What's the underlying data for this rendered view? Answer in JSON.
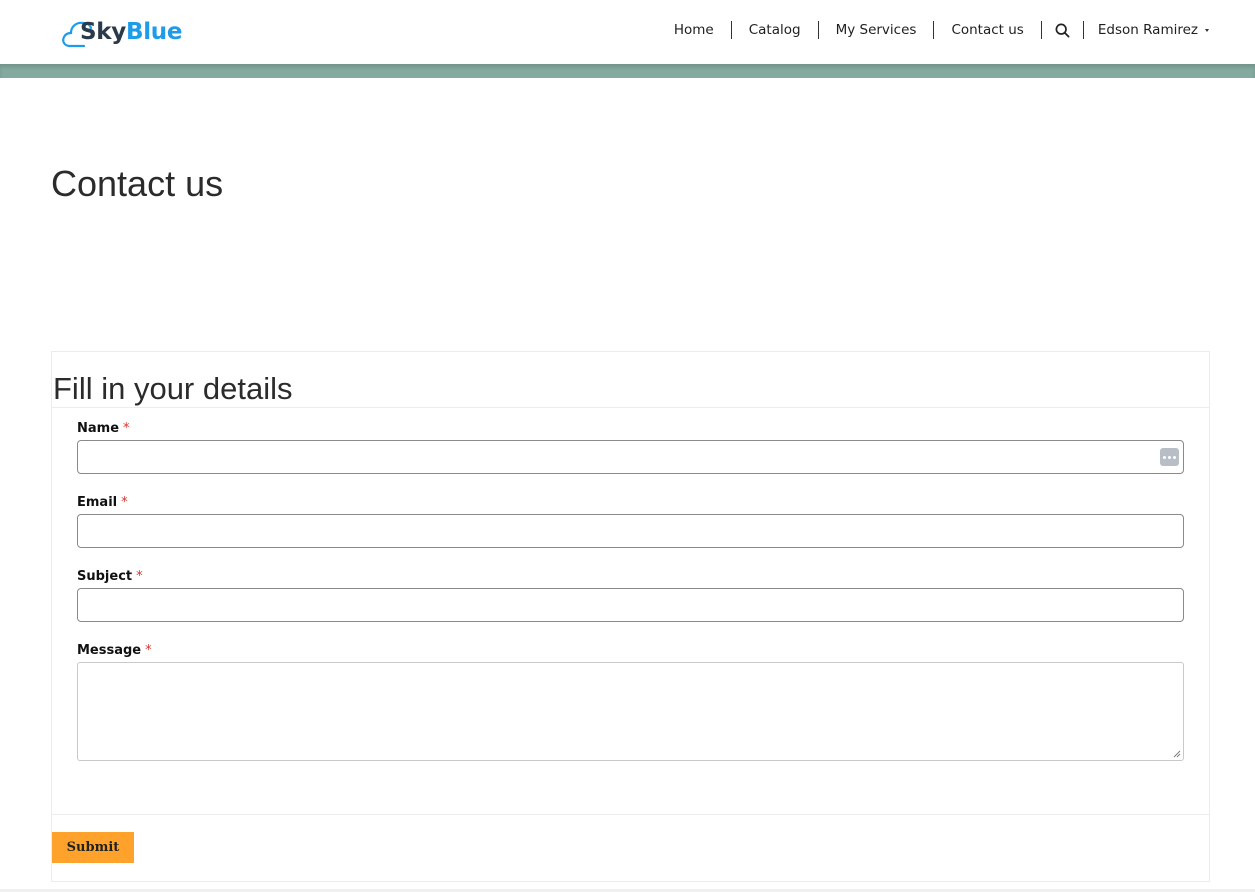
{
  "brand": {
    "name_part1": "Sky",
    "name_part2": "Blue",
    "color_primary": "#2a3a4a",
    "color_accent": "#1e9ce9",
    "icon": "cloud-icon"
  },
  "nav": {
    "items": [
      {
        "label": "Home"
      },
      {
        "label": "Catalog"
      },
      {
        "label": "My Services"
      },
      {
        "label": "Contact us"
      }
    ],
    "search_icon": "search-icon",
    "user_name": "Edson Ramirez",
    "user_menu_icon": "caret-down-icon"
  },
  "header_band_color": "#84a99f",
  "page": {
    "title": "Contact us"
  },
  "form": {
    "title": "Fill in your details",
    "required_marker": "*",
    "fields": {
      "name": {
        "label": "Name",
        "value": ""
      },
      "email": {
        "label": "Email",
        "value": ""
      },
      "subject": {
        "label": "Subject",
        "value": ""
      },
      "message": {
        "label": "Message",
        "value": ""
      }
    },
    "submit_label": "Submit",
    "submit_color": "#ffa22b"
  }
}
